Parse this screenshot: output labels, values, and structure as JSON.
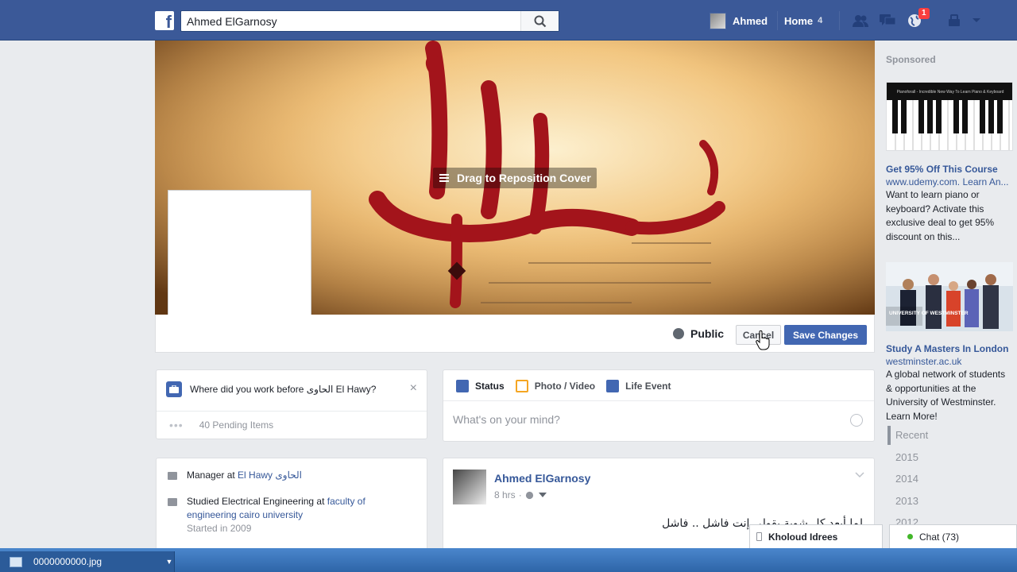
{
  "topbar": {
    "logo": "f",
    "search_value": "Ahmed ElGarnosy",
    "profile_name": "Ahmed",
    "home_label": "Home",
    "home_count": "4",
    "notifications_count": "1"
  },
  "cover": {
    "reposition_label": "Drag to Reposition Cover",
    "privacy_label": "Public",
    "cancel_label": "Cancel",
    "save_label": "Save Changes"
  },
  "work_prompt": {
    "question": "Where did you work before الحاوى El Hawy?",
    "pending": "40 Pending Items"
  },
  "about": {
    "job_prefix": "Manager at ",
    "job_link": "El Hawy الحاوى",
    "edu_prefix": "Studied Electrical Engineering at ",
    "edu_link": "faculty of engineering cairo university",
    "edu_started": "Started in 2009"
  },
  "composer": {
    "tabs": [
      {
        "label": "Status",
        "color": "#4267b2"
      },
      {
        "label": "Photo / Video",
        "color": "#f5a623"
      },
      {
        "label": "Life Event",
        "color": "#4267b2"
      }
    ],
    "placeholder": "What's on your mind?"
  },
  "post": {
    "author": "Ahmed ElGarnosy",
    "time": "8 hrs",
    "text": "لما أبعد كل شوية يقولي إنت فاشل .. فاشل"
  },
  "sidebar": {
    "sponsored_label": "Sponsored",
    "ads": [
      {
        "image_caption": "Pianoforall - Incredible New Way To Learn Piano & Keyboard",
        "title": "Get 95% Off This Course",
        "url": "www.udemy.com. Learn An...",
        "description": "Want to learn piano or keyboard? Activate this exclusive deal to get 95% discount on this..."
      },
      {
        "image_caption": "UNIVERSITY OF WESTMINSTER",
        "title": "Study A Masters In London",
        "url": "westminster.ac.uk",
        "description": "A global network of students & opportunities at the University of Westminster. Learn More!"
      }
    ],
    "timeline": [
      "Recent",
      "2015",
      "2014",
      "2013",
      "2012"
    ]
  },
  "chat": {
    "contact": "Kholoud Idrees",
    "chat_label": "Chat (73)"
  },
  "download_bar": {
    "file_name": "0000000000.jpg"
  },
  "colors": {
    "brand": "#3b5998",
    "primary_button": "#4267b2",
    "link": "#365899",
    "online": "#42b72a",
    "badge": "#fa3e3e"
  }
}
